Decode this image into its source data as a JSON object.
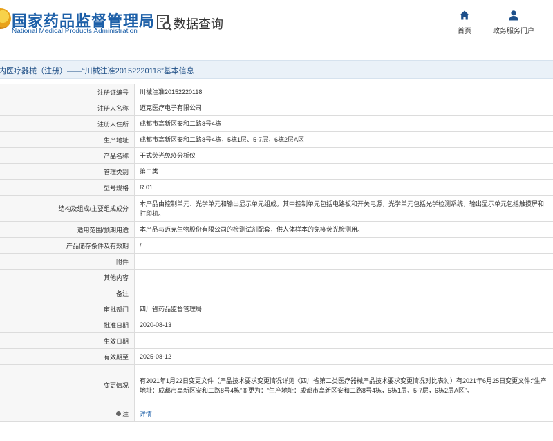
{
  "header": {
    "org_name_cn": "国家药品监督管理局",
    "org_name_en": "National Medical Products Administration",
    "query_title": "数据查询",
    "nav": {
      "home_label": "首页",
      "portal_label": "政务服务门户"
    }
  },
  "title_bar": {
    "text": "内医疗器械（注册）——“川械注准20152220118”基本信息"
  },
  "detail_rows": [
    {
      "label": "注册证编号",
      "value": "川械注准20152220118"
    },
    {
      "label": "注册人名称",
      "value": "迈克医疗电子有限公司"
    },
    {
      "label": "注册人住所",
      "value": "成都市高新区安和二路8号4栋"
    },
    {
      "label": "生产地址",
      "value": "成都市高新区安和二路8号4栋，5栋1层、5-7层，6栋2层A区"
    },
    {
      "label": "产品名称",
      "value": "干式荧光免疫分析仪"
    },
    {
      "label": "管理类别",
      "value": "第二类"
    },
    {
      "label": "型号规格",
      "value": "R 01"
    },
    {
      "label": "结构及组成/主要组成成分",
      "value": "本产品由控制单元、光学单元和输出显示单元组成。其中控制单元包括电路板和开关电源，光学单元包括光学检测系统，输出显示单元包括触摸屏和打印机。"
    },
    {
      "label": "适用范围/预期用途",
      "value": "本产品与迈克生物股份有限公司的检测试剂配套，供人体样本的免疫荧光检测用。"
    },
    {
      "label": "产品储存条件及有效期",
      "value": "/"
    },
    {
      "label": "附件",
      "value": ""
    },
    {
      "label": "其他内容",
      "value": ""
    },
    {
      "label": "备注",
      "value": ""
    },
    {
      "label": "审批部门",
      "value": "四川省药品监督管理局"
    },
    {
      "label": "批准日期",
      "value": "2020-08-13"
    },
    {
      "label": "生效日期",
      "value": ""
    },
    {
      "label": "有效期至",
      "value": "2025-08-12"
    },
    {
      "label": "变更情况",
      "value": "有2021年1月22日变更文件（产品技术要求变更情况详见《四川省第二类医疗器械产品技术要求变更情况对比表》。）有2021年6月25日变更文件:“生产地址：成都市高新区安和二路8号4栋”变更为：“生产地址：成都市高新区安和二路8号4栋，5栋1层、5-7层，6栋2层A区”。"
    },
    {
      "label": "注",
      "value": "详情"
    }
  ],
  "colors": {
    "brand_blue": "#1c5fa8",
    "title_bar_bg": "#eaf1f8",
    "label_bg": "#f7f7f7",
    "border": "#dcdcdc"
  },
  "icons": {
    "logo": "emblem-icon",
    "query": "document-search-icon",
    "home": "home-icon",
    "portal": "user-icon",
    "note": "note-icon"
  }
}
